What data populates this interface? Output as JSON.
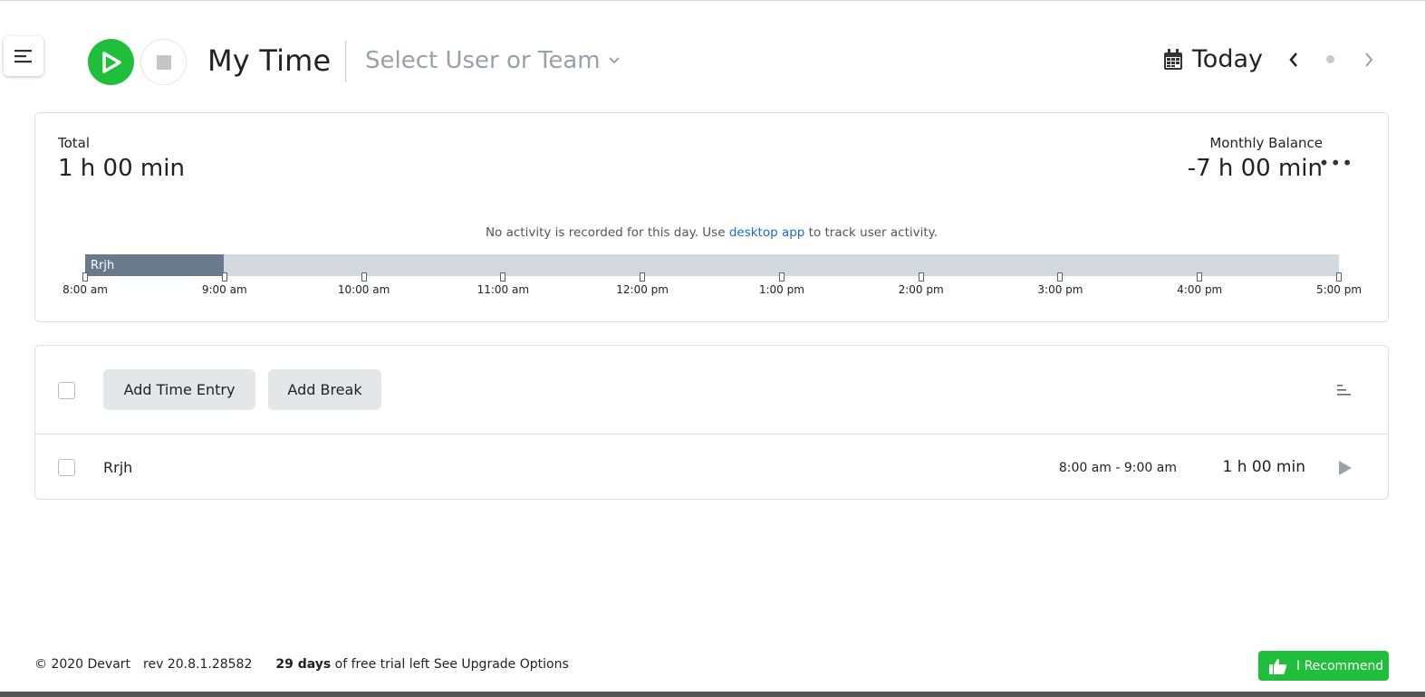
{
  "header": {
    "title": "My Time",
    "user_select": "Select User or Team",
    "date_label": "Today"
  },
  "summary": {
    "total_label": "Total",
    "total_value": "1 h 00 min",
    "balance_label": "Monthly Balance",
    "balance_value": "-7 h 00 min",
    "activity_note_prefix": "No activity is recorded for this day. Use ",
    "activity_link": "desktop app",
    "activity_note_suffix": " to track user activity.",
    "timeline": {
      "entry_label": "Rrjh",
      "ticks": [
        "8:00 am",
        "9:00 am",
        "10:00 am",
        "11:00 am",
        "12:00 pm",
        "1:00 pm",
        "2:00 pm",
        "3:00 pm",
        "4:00 pm",
        "5:00 pm"
      ]
    }
  },
  "entries": {
    "add_time_entry": "Add Time Entry",
    "add_break": "Add Break",
    "rows": [
      {
        "name": "Rrjh",
        "range": "8:00 am - 9:00 am",
        "duration": "1 h 00 min"
      }
    ]
  },
  "footer": {
    "copyright": "© 2020 Devart",
    "revision": "rev 20.8.1.28582",
    "trial_days": "29 days",
    "trial_text": " of free trial left ",
    "upgrade_link": "See Upgrade Options",
    "recommend": "I Recommend"
  },
  "colors": {
    "accent_green": "#1fbf3c",
    "link_blue": "#1a6ad9",
    "timeline_entry": "#687a8c",
    "timeline_track": "#d4d8df"
  },
  "icons": [
    "menu-icon",
    "play-icon",
    "stop-icon",
    "chevron-down-icon",
    "calendar-icon",
    "chevron-left-icon",
    "chevron-right-icon",
    "more-icon",
    "sort-icon",
    "thumbs-up-icon"
  ]
}
